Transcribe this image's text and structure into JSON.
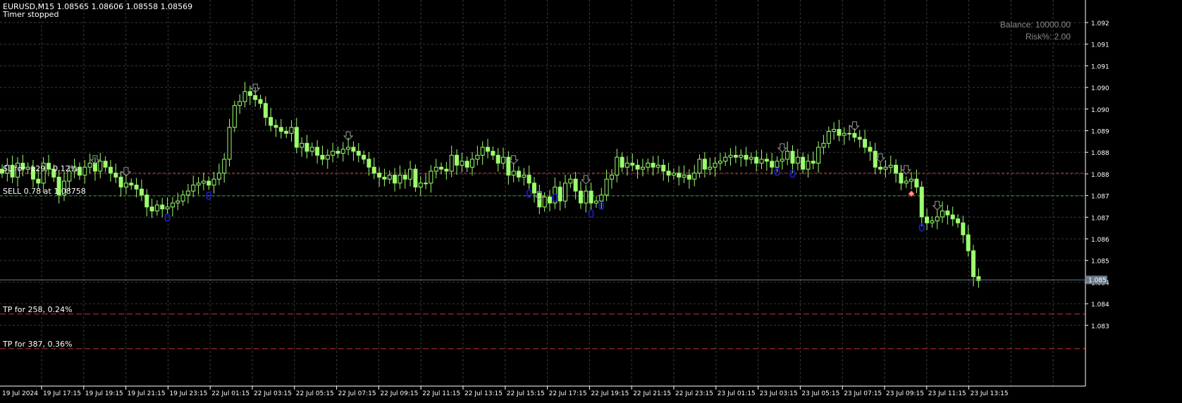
{
  "header": {
    "symbol_line": "EURUSD,M15  1.08565 1.08606 1.08558 1.08569",
    "status": "Timer stopped"
  },
  "panel": {
    "balance": "Balance: 10000.00",
    "risk": "Risk%: 2.00"
  },
  "lines": {
    "sl": {
      "label": "SL for -129, -0.12%",
      "price": 1.08815,
      "color": "#c8323c"
    },
    "entry": {
      "label": "SELL 0.78 at 1.08758",
      "price": 1.08758,
      "color": "#3ca03c"
    },
    "tp1": {
      "label": "TP for 258, 0.24%",
      "price": 1.08461,
      "color": "#c8323c"
    },
    "tp2": {
      "label": "TP for 387, 0.36%",
      "price": 1.08374,
      "color": "#c8323c"
    }
  },
  "colors": {
    "background": "#000000",
    "grid": "#3a3a3a",
    "candle": "#9cff6e",
    "axis": "#ffffff",
    "arrow": "#9a9a9a",
    "signal": "#1a1aa8",
    "current_price_bg": "#6b7b8c"
  },
  "current_price": "1.085",
  "price_axis": [
    "1.092",
    "1.091",
    "1.091",
    "1.090",
    "1.090",
    "1.089",
    "1.088",
    "1.088",
    "1.087",
    "1.087",
    "1.086",
    "1.085",
    "1.084",
    "1.084",
    "1.083"
  ],
  "time_axis": [
    "19 Jul 2024",
    "19 Jul 17:15",
    "19 Jul 19:15",
    "19 Jul 21:15",
    "19 Jul 23:15",
    "22 Jul 01:15",
    "22 Jul 03:15",
    "22 Jul 05:15",
    "22 Jul 07:15",
    "22 Jul 09:15",
    "22 Jul 11:15",
    "22 Jul 13:15",
    "22 Jul 15:15",
    "22 Jul 17:15",
    "22 Jul 19:15",
    "22 Jul 21:15",
    "22 Jul 23:15",
    "23 Jul 01:15",
    "23 Jul 03:15",
    "23 Jul 05:15",
    "23 Jul 07:15",
    "23 Jul 09:15",
    "23 Jul 11:15",
    "23 Jul 13:15"
  ],
  "chart_data": {
    "type": "candlestick",
    "symbol": "EURUSD",
    "timeframe": "M15",
    "ylim": [
      1.0828,
      1.0925
    ],
    "first_bar": "19 Jul 2024 15:15",
    "bar_minutes": 15,
    "closes": [
      1.08815,
      1.08835,
      1.08805,
      1.0884,
      1.08825,
      1.0883,
      1.088,
      1.0879,
      1.0884,
      1.08825,
      1.08805,
      1.0876,
      1.08795,
      1.0882,
      1.0883,
      1.0881,
      1.0883,
      1.0884,
      1.0882,
      1.08845,
      1.0883,
      1.08815,
      1.08805,
      1.0878,
      1.0879,
      1.08785,
      1.08775,
      1.0876,
      1.0873,
      1.0872,
      1.08735,
      1.08725,
      1.0873,
      1.0874,
      1.08745,
      1.0876,
      1.0877,
      1.08785,
      1.0879,
      1.08795,
      1.08785,
      1.088,
      1.08815,
      1.0885,
      1.0893,
      1.08985,
      1.08995,
      1.0902,
      1.0901,
      1.09,
      1.0899,
      1.08955,
      1.08935,
      1.0893,
      1.0892,
      1.08915,
      1.0893,
      1.0888,
      1.0889,
      1.0887,
      1.0888,
      1.0886,
      1.0885,
      1.0886,
      1.0887,
      1.08865,
      1.08875,
      1.0888,
      1.0887,
      1.0886,
      1.0885,
      1.0883,
      1.08815,
      1.08805,
      1.088,
      1.0881,
      1.0879,
      1.0881,
      1.088,
      1.08825,
      1.0878,
      1.0879,
      1.0879,
      1.0882,
      1.0883,
      1.08825,
      1.0882,
      1.0886,
      1.08835,
      1.08845,
      1.0883,
      1.0885,
      1.0886,
      1.0888,
      1.0887,
      1.0886,
      1.0884,
      1.08855,
      1.0881,
      1.0882,
      1.08805,
      1.0881,
      1.0879,
      1.08765,
      1.0873,
      1.08755,
      1.0874,
      1.0878,
      1.08745,
      1.0879,
      1.088,
      1.0877,
      1.0874,
      1.0877,
      1.0874,
      1.08745,
      1.0876,
      1.088,
      1.0881,
      1.08855,
      1.0883,
      1.0884,
      1.08835,
      1.08825,
      1.0883,
      1.0884,
      1.0883,
      1.08835,
      1.0882,
      1.0881,
      1.08815,
      1.08805,
      1.0881,
      1.088,
      1.08815,
      1.0885,
      1.08825,
      1.0883,
      1.0884,
      1.08845,
      1.08855,
      1.0886,
      1.08855,
      1.0886,
      1.0885,
      1.08855,
      1.0884,
      1.0885,
      1.08845,
      1.0883,
      1.08845,
      1.0885,
      1.0887,
      1.0884,
      1.08855,
      1.08825,
      1.08845,
      1.0884,
      1.0888,
      1.0889,
      1.0892,
      1.08925,
      1.0891,
      1.08915,
      1.08915,
      1.08905,
      1.089,
      1.0888,
      1.0887,
      1.0883,
      1.08825,
      1.0883,
      1.08835,
      1.08815,
      1.0879,
      1.08795,
      1.088,
      1.0878,
      1.08705,
      1.0869,
      1.08695,
      1.08705,
      1.0872,
      1.0871,
      1.087,
      1.0869,
      1.0866,
      1.0862,
      1.08555,
      1.08545
    ]
  }
}
